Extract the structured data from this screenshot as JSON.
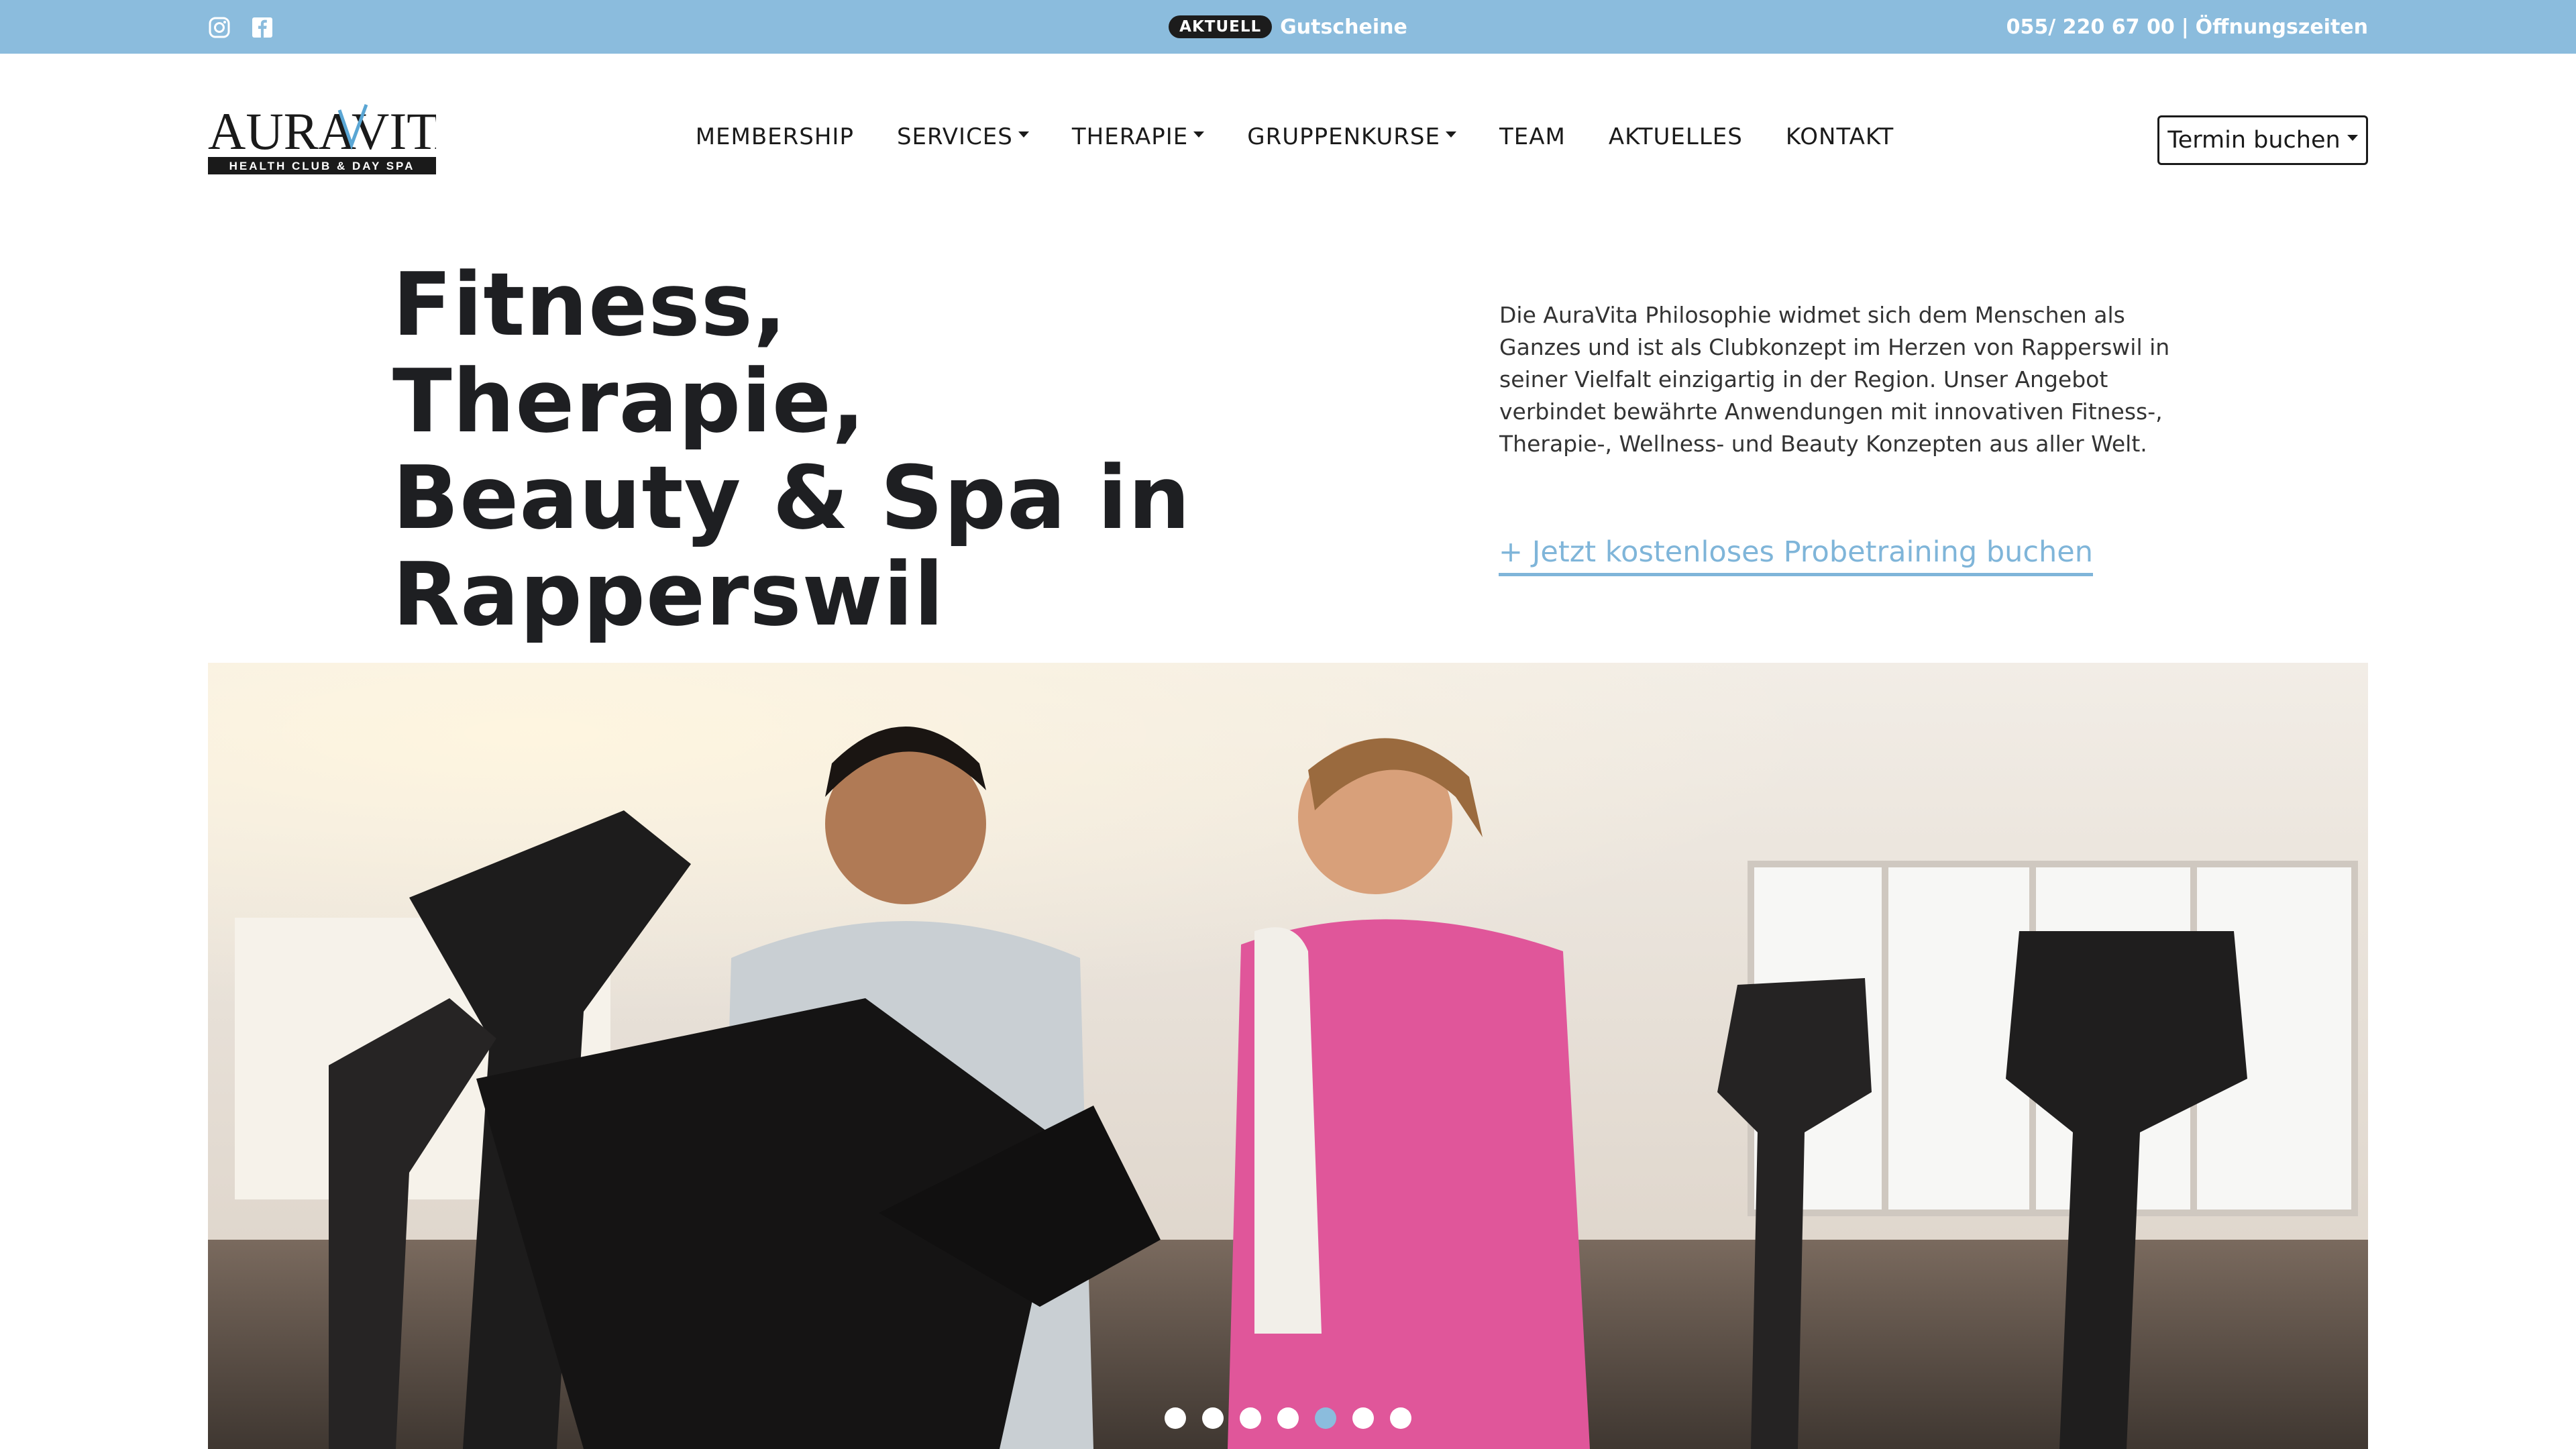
{
  "topbar": {
    "icons": [
      "instagram-icon",
      "facebook-icon"
    ],
    "badge": "AKTUELL",
    "promo_link": "Gutscheine",
    "phone": "055/ 220 67 00",
    "separator": "|",
    "hours_link": "Öffnungszeiten"
  },
  "logo": {
    "name_left": "AURA",
    "name_right": "VITA",
    "tagline": "HEALTH CLUB & DAY SPA"
  },
  "nav": {
    "items": [
      {
        "label": "MEMBERSHIP"
      },
      {
        "label": "SERVICES"
      },
      {
        "label": "THERAPIE"
      },
      {
        "label": "GRUPPENKURSE"
      },
      {
        "label": "TEAM"
      },
      {
        "label": "AKTUELLES"
      },
      {
        "label": "KONTAKT"
      }
    ],
    "book_button": "Termin buchen"
  },
  "hero": {
    "title_line1": "Fitness, Therapie,",
    "title_line2": "Beauty & Spa in",
    "title_line3": "Rapperswil",
    "description": "Die AuraVita Philosophie widmet sich dem Menschen als Ganzes und ist als Clubkonzept im Herzen von Rapperswil in seiner Vielfalt einzigartig in der Region. Unser Angebot verbindet bewährte Anwendungen mit innovativen Fitness-, Therapie-, Wellness- und Beauty Konzepten aus aller Welt.",
    "cta": "+ Jetzt kostenloses Probetraining buchen"
  },
  "carousel": {
    "total_slides": 7,
    "active_slide": 5
  },
  "colors": {
    "topbar": "#8bbcdd",
    "accent": "#7fb5d9",
    "text_dark": "#1e1f22"
  }
}
